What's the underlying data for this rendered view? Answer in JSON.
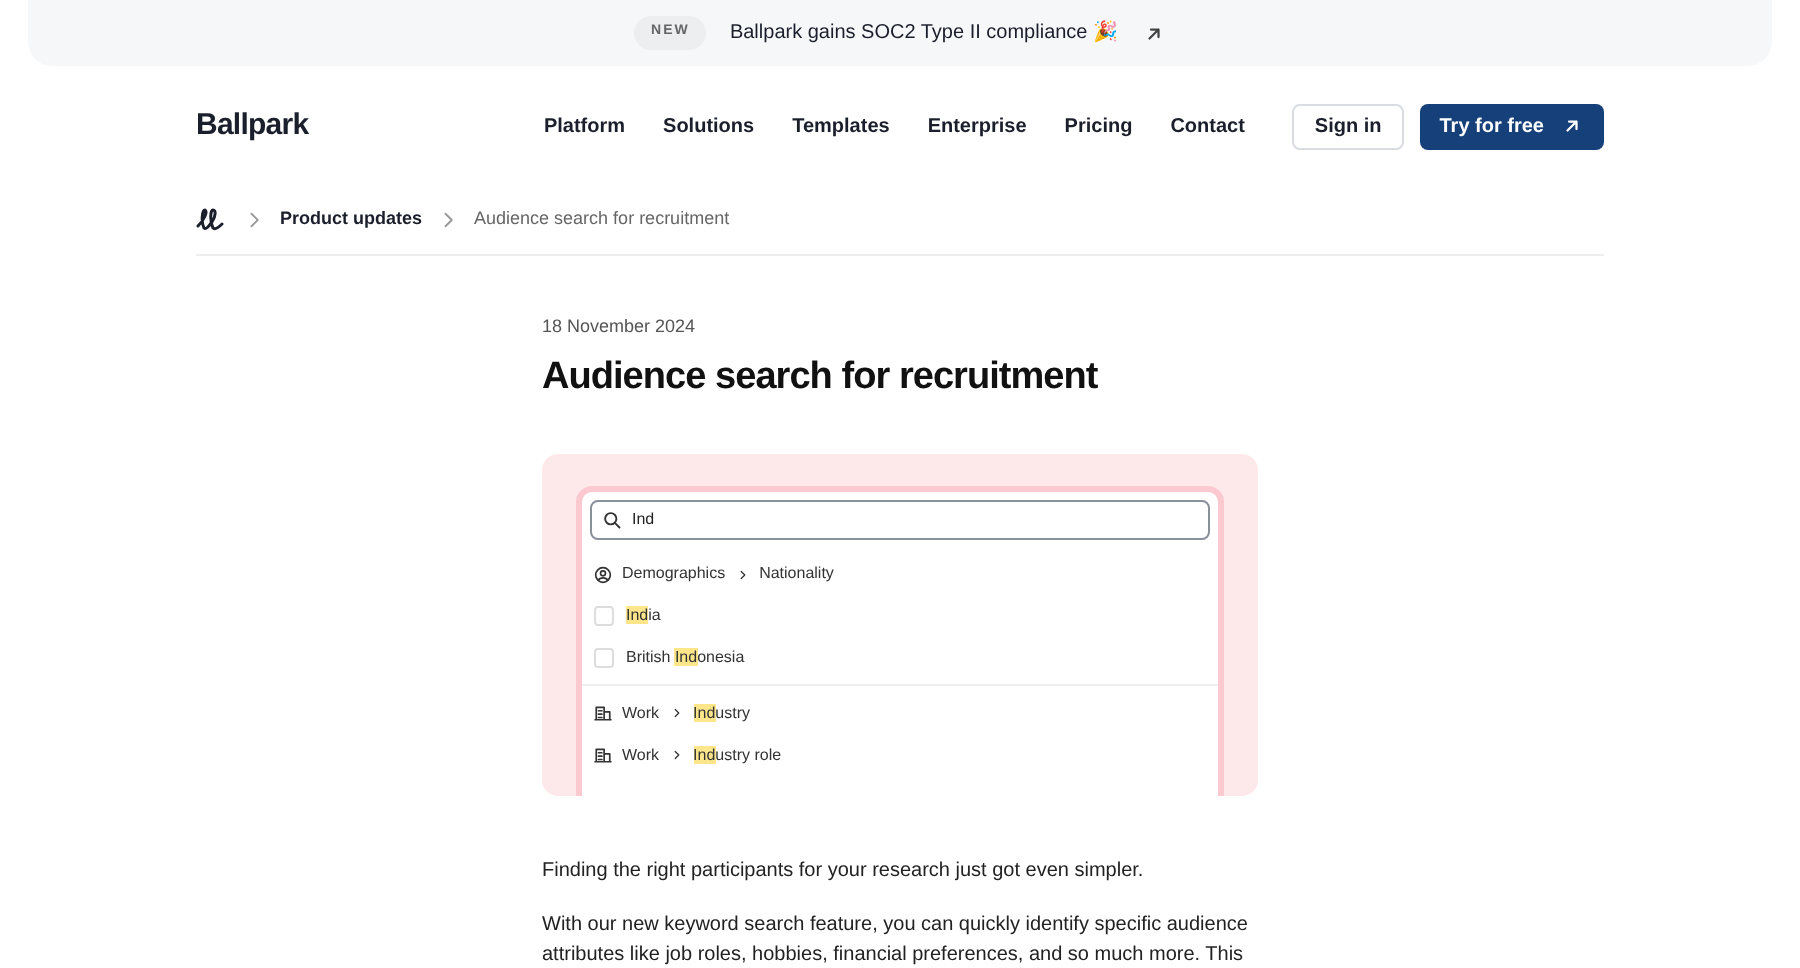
{
  "banner": {
    "badge": "NEW",
    "text": "Ballpark gains SOC2 Type II compliance 🎉"
  },
  "nav": {
    "logo": "Ballpark",
    "links": [
      "Platform",
      "Solutions",
      "Templates",
      "Enterprise",
      "Pricing",
      "Contact"
    ],
    "sign_in": "Sign in",
    "cta": "Try for free"
  },
  "breadcrumb": [
    {
      "label": "Product updates",
      "current": false
    },
    {
      "label": "Audience search for recruitment",
      "current": true
    }
  ],
  "article": {
    "date": "18 November 2024",
    "title": "Audience search for recruitment",
    "mockup": {
      "search_value": "Ind",
      "groups": [
        {
          "kind": "category",
          "path": [
            {
              "rest": "Demographics"
            },
            {
              "rest": "Nationality"
            }
          ],
          "options": [
            {
              "match": "Ind",
              "rest": "ia",
              "checked": false
            },
            {
              "pre": "British ",
              "match": "Ind",
              "rest": "onesia",
              "checked": false
            }
          ]
        },
        {
          "kind": "path",
          "path": [
            {
              "rest": "Work"
            },
            {
              "match": "Ind",
              "rest": "ustry"
            }
          ]
        },
        {
          "kind": "path",
          "path": [
            {
              "rest": "Work"
            },
            {
              "match": "Ind",
              "rest": "ustry role"
            }
          ]
        }
      ]
    },
    "paragraphs": [
      "Finding the right participants for your research just got even simpler.",
      "With our new keyword search feature, you can quickly identify specific audience attributes like job roles, hobbies, financial preferences, and so much more. This"
    ]
  }
}
